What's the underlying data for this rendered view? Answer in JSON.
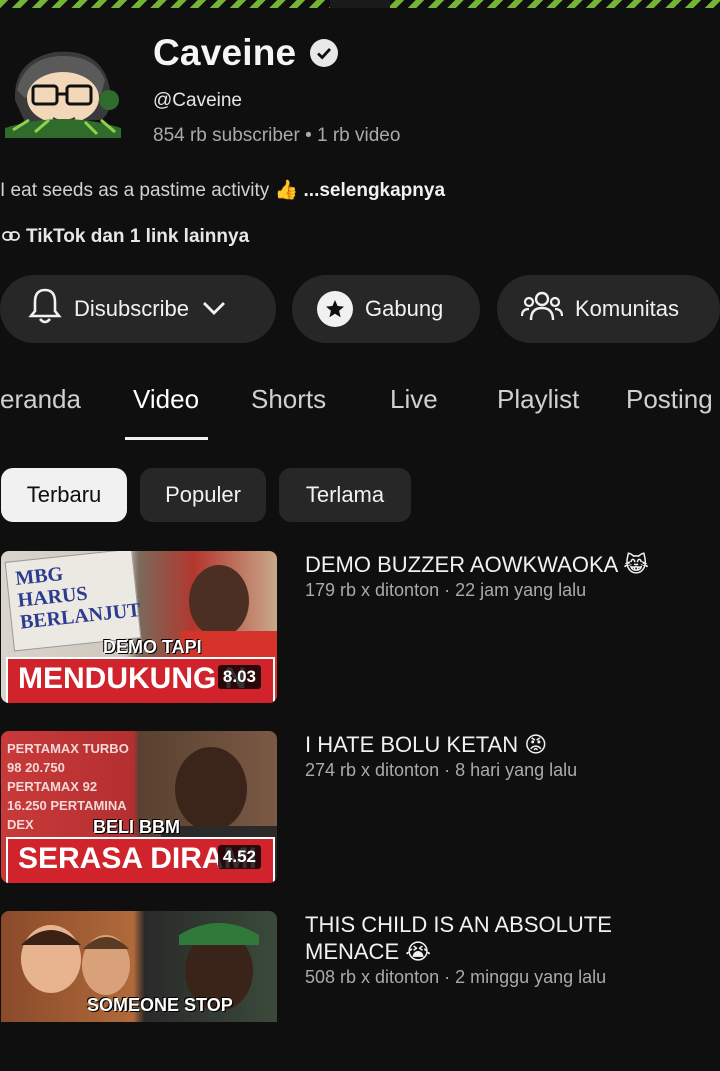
{
  "channel": {
    "name": "Caveine",
    "handle": "@Caveine",
    "stats": "854 rb subscriber • 1 rb video",
    "description": "I eat seeds as a pastime activity 👍",
    "more": "...selengkapnya",
    "links": "TikTok dan 1 link lainnya"
  },
  "actions": {
    "subscribe": "Disubscribe",
    "join": "Gabung",
    "community": "Komunitas"
  },
  "tabs": [
    "eranda",
    "Video",
    "Shorts",
    "Live",
    "Playlist",
    "Posting"
  ],
  "active_tab": "Video",
  "chips": [
    "Terbaru",
    "Populer",
    "Terlama"
  ],
  "selected_chip": "Terbaru",
  "videos": [
    {
      "title": "DEMO BUZZER AOWKWAOKA 😹",
      "meta": "179 rb x ditonton · 22 jam yang lalu",
      "duration": "8.03",
      "thumb_sign": "MBG HARUS BERLANJUT",
      "thumb_small": "DEMO TAPI",
      "thumb_big": "MENDUKUNG N"
    },
    {
      "title": "I HATE BOLU KETAN 😡",
      "meta": "274 rb x ditonton · 8 hari yang lalu",
      "duration": "4.52",
      "thumb_sign": "PERTAMAX TURBO 98 20.750 PERTAMAX 92 16.250 PERTAMINA DEX",
      "thumb_small": "BELI BBM",
      "thumb_big": "SERASA DIRAMI"
    },
    {
      "title": "THIS CHILD IS AN ABSOLUTE MENACE 😭",
      "meta": "508 rb x ditonton · 2 minggu yang lalu",
      "duration": "",
      "thumb_small": "SOMEONE STOP"
    }
  ],
  "colors": {
    "background": "#0f0f0f",
    "chip": "#272727",
    "accent_red": "#d0232c",
    "banner_green": "#7ec83a"
  }
}
